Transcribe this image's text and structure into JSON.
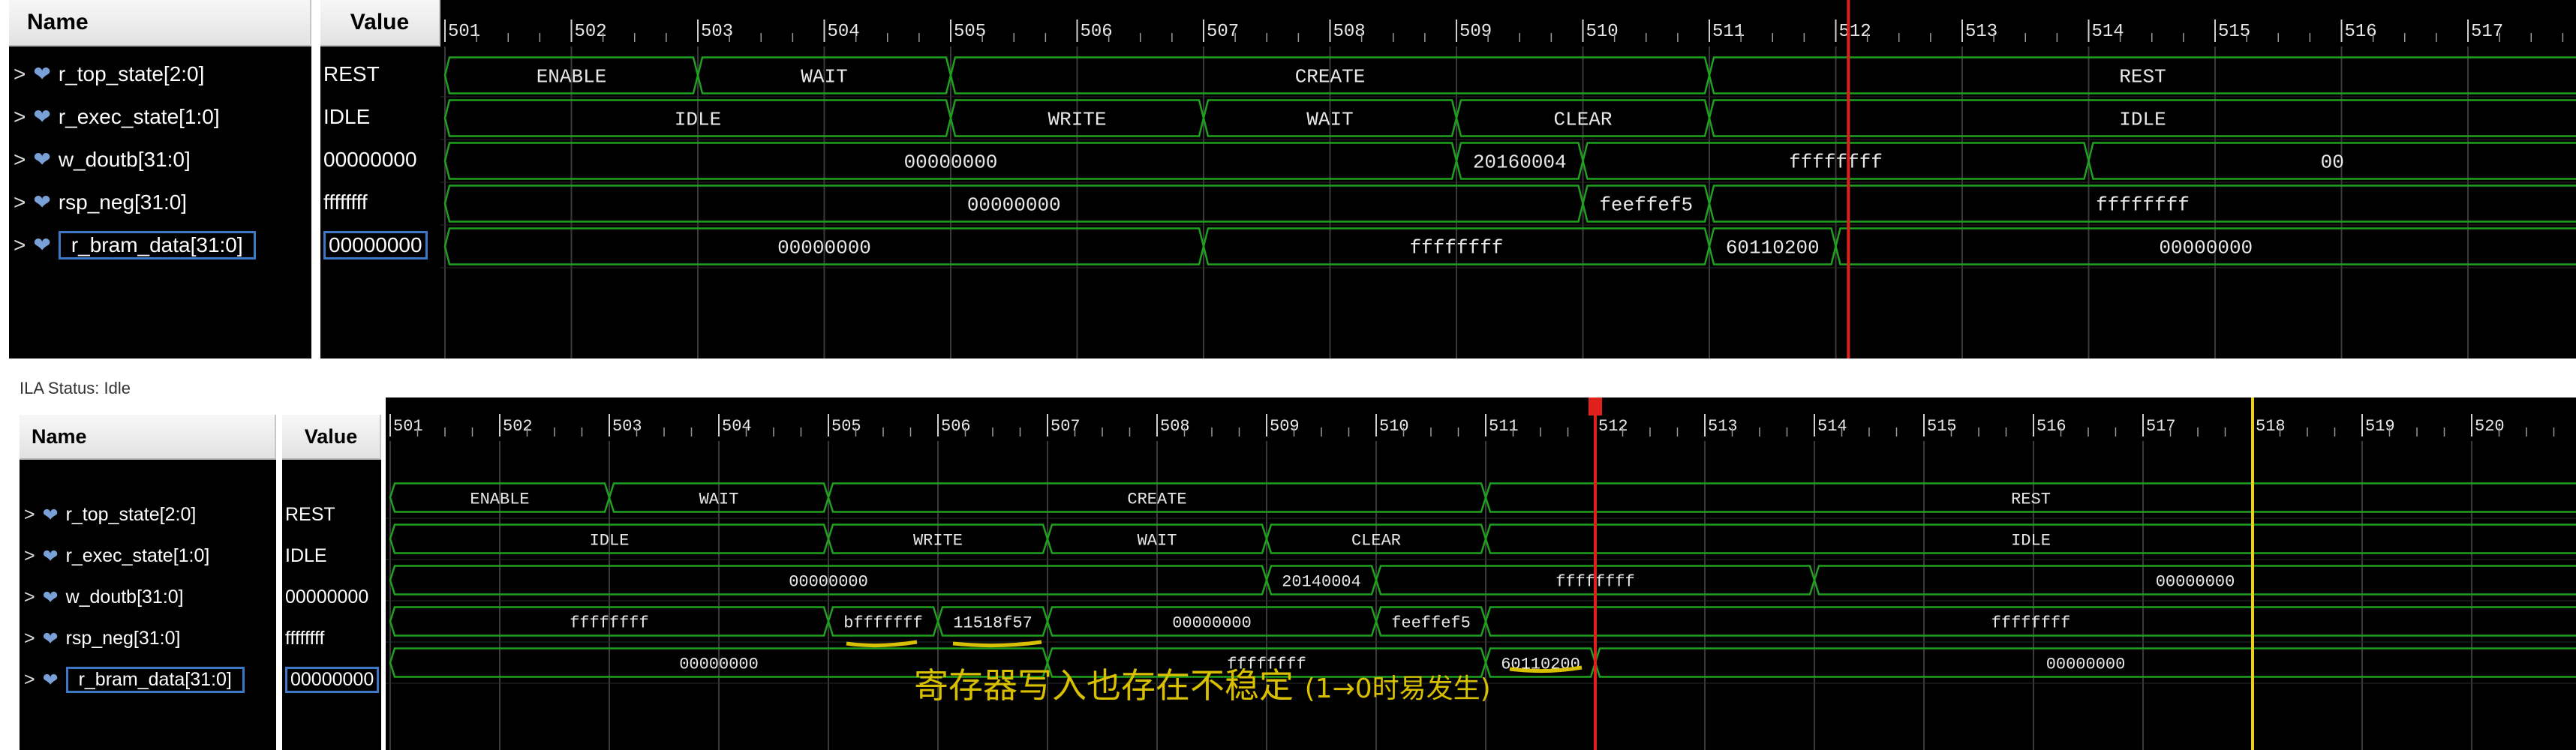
{
  "panels": [
    {
      "header": {
        "name": "Name",
        "value": "Value"
      },
      "ticks": [
        "501",
        "502",
        "503",
        "504",
        "505",
        "506",
        "507",
        "508",
        "509",
        "510",
        "511",
        "512",
        "513",
        "514",
        "515",
        "516",
        "517"
      ],
      "signals": [
        {
          "name": "r_top_state[2:0]",
          "value": "REST",
          "selected": false,
          "segments": [
            {
              "s": 0,
              "e": 2,
              "label": "ENABLE"
            },
            {
              "s": 2,
              "e": 4,
              "label": "WAIT"
            },
            {
              "s": 4,
              "e": 10,
              "label": "CREATE"
            },
            {
              "s": 10,
              "e": 17.5,
              "label": "REST"
            }
          ]
        },
        {
          "name": "r_exec_state[1:0]",
          "value": "IDLE",
          "selected": false,
          "segments": [
            {
              "s": 0,
              "e": 4,
              "label": "IDLE"
            },
            {
              "s": 4,
              "e": 6,
              "label": "WRITE"
            },
            {
              "s": 6,
              "e": 8,
              "label": "WAIT"
            },
            {
              "s": 8,
              "e": 10,
              "label": "CLEAR"
            },
            {
              "s": 10,
              "e": 17.5,
              "label": "IDLE"
            }
          ]
        },
        {
          "name": "w_doutb[31:0]",
          "value": "00000000",
          "selected": false,
          "segments": [
            {
              "s": 0,
              "e": 8,
              "label": "00000000"
            },
            {
              "s": 8,
              "e": 9,
              "label": "20160004"
            },
            {
              "s": 9,
              "e": 13,
              "label": "ffffffff"
            },
            {
              "s": 13,
              "e": 17.5,
              "label": "00"
            }
          ]
        },
        {
          "name": "rsp_neg[31:0]",
          "value": "ffffffff",
          "selected": false,
          "segments": [
            {
              "s": 0,
              "e": 9,
              "label": "00000000"
            },
            {
              "s": 9,
              "e": 10,
              "label": "feeffef5"
            },
            {
              "s": 10,
              "e": 17.5,
              "label": "ffffffff"
            }
          ]
        },
        {
          "name": "r_bram_data[31:0]",
          "value": "00000000",
          "selected": true,
          "segments": [
            {
              "s": 0,
              "e": 6,
              "label": "00000000"
            },
            {
              "s": 6,
              "e": 10,
              "label": "ffffffff"
            },
            {
              "s": 10,
              "e": 11,
              "label": "60110200"
            },
            {
              "s": 11,
              "e": 17.5,
              "label": "00000000"
            }
          ]
        }
      ],
      "cursor_red": 11.1
    },
    {
      "status": "ILA Status: Idle",
      "header": {
        "name": "Name",
        "value": "Value"
      },
      "ticks": [
        "501",
        "502",
        "503",
        "504",
        "505",
        "506",
        "507",
        "508",
        "509",
        "510",
        "511",
        "512",
        "513",
        "514",
        "515",
        "516",
        "517",
        "518",
        "519",
        "520"
      ],
      "signals": [
        {
          "name": "r_top_state[2:0]",
          "value": "REST",
          "selected": false,
          "segments": [
            {
              "s": 0,
              "e": 2,
              "label": "ENABLE"
            },
            {
              "s": 2,
              "e": 4,
              "label": "WAIT"
            },
            {
              "s": 4,
              "e": 10,
              "label": "CREATE"
            },
            {
              "s": 10,
              "e": 20.5,
              "label": "REST"
            }
          ]
        },
        {
          "name": "r_exec_state[1:0]",
          "value": "IDLE",
          "selected": false,
          "segments": [
            {
              "s": 0,
              "e": 4,
              "label": "IDLE"
            },
            {
              "s": 4,
              "e": 6,
              "label": "WRITE"
            },
            {
              "s": 6,
              "e": 8,
              "label": "WAIT"
            },
            {
              "s": 8,
              "e": 10,
              "label": "CLEAR"
            },
            {
              "s": 10,
              "e": 20.5,
              "label": "IDLE"
            }
          ]
        },
        {
          "name": "w_doutb[31:0]",
          "value": "00000000",
          "selected": false,
          "segments": [
            {
              "s": 0,
              "e": 8,
              "label": "00000000"
            },
            {
              "s": 8,
              "e": 9,
              "label": "20140004"
            },
            {
              "s": 9,
              "e": 13,
              "label": "ffffffff"
            },
            {
              "s": 13,
              "e": 20.5,
              "label": "00000000"
            }
          ]
        },
        {
          "name": "rsp_neg[31:0]",
          "value": "ffffffff",
          "selected": false,
          "segments": [
            {
              "s": 0,
              "e": 4,
              "label": "ffffffff"
            },
            {
              "s": 4,
              "e": 5,
              "label": "bfffffff"
            },
            {
              "s": 5,
              "e": 6,
              "label": "11518f57"
            },
            {
              "s": 6,
              "e": 9,
              "label": "00000000"
            },
            {
              "s": 9,
              "e": 10,
              "label": "feeffef5"
            },
            {
              "s": 10,
              "e": 20.5,
              "label": "ffffffff"
            }
          ]
        },
        {
          "name": "r_bram_data[31:0]",
          "value": "00000000",
          "selected": true,
          "segments": [
            {
              "s": 0,
              "e": 6,
              "label": "00000000"
            },
            {
              "s": 6,
              "e": 10,
              "label": "ffffffff"
            },
            {
              "s": 10,
              "e": 11,
              "label": "60110200"
            },
            {
              "s": 11,
              "e": 20.5,
              "label": "00000000"
            }
          ]
        }
      ],
      "cursor_red": 11,
      "cursor_yellow": 17
    }
  ],
  "annotation": {
    "main": "寄存器写入也存在不稳定",
    "paren": "(1→0时易发生)"
  },
  "colors": {
    "wave": "#1fa01f",
    "text": "#e8e8e8",
    "cursor_red": "#e0201a",
    "cursor_yellow": "#e8d020",
    "annotation": "#d8c000"
  }
}
